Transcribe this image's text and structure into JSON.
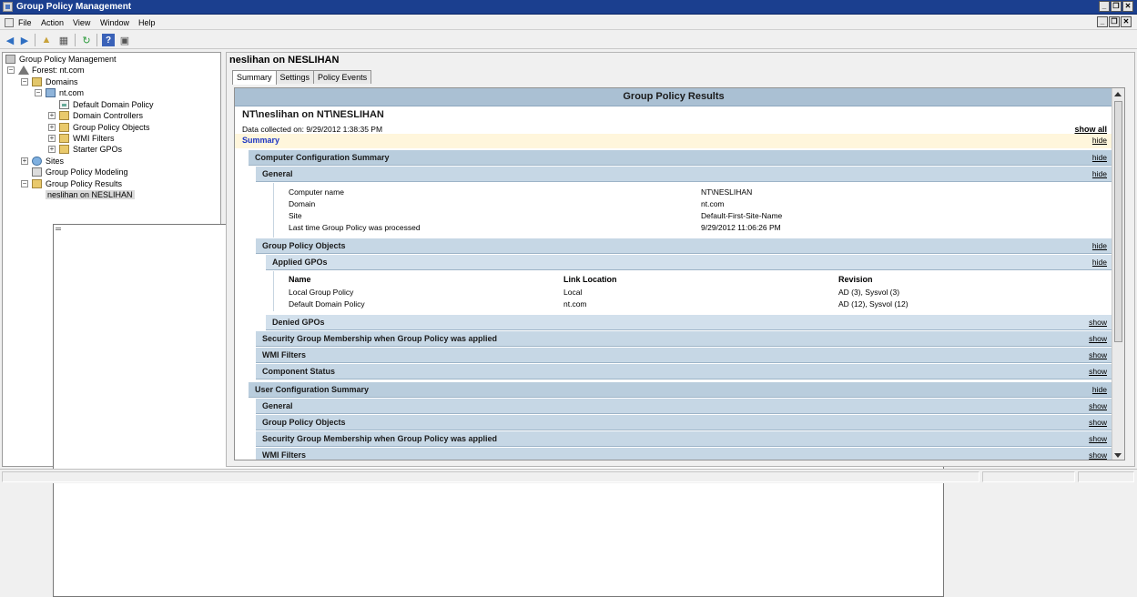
{
  "window": {
    "title": "Group Policy Management"
  },
  "menu": [
    "File",
    "Action",
    "View",
    "Window",
    "Help"
  ],
  "toolbar": [
    "back-arrow-icon",
    "forward-arrow-icon",
    "up-folder-icon",
    "show-hide-tree-icon",
    "refresh-icon",
    "help-icon",
    "properties-icon"
  ],
  "tree": {
    "root": "Group Policy Management",
    "forest": "Forest: nt.com",
    "domains": "Domains",
    "domain": "nt.com",
    "default_domain_policy": "Default Domain Policy",
    "domain_controllers": "Domain Controllers",
    "gpo": "Group Policy Objects",
    "wmi": "WMI Filters",
    "starter": "Starter GPOs",
    "sites": "Sites",
    "modeling": "Group Policy Modeling",
    "results": "Group Policy Results",
    "result_item": "neslihan on NESLIHAN"
  },
  "pane": {
    "title": "neslihan on NESLIHAN",
    "tabs": [
      "Summary",
      "Settings",
      "Policy Events"
    ]
  },
  "report": {
    "banner": "Group Policy Results",
    "heading": "NT\\neslihan on NT\\NESLIHAN",
    "collected": "Data collected on: 9/29/2012 1:38:35 PM",
    "show_all": "show all",
    "summary": "Summary",
    "hide": "hide",
    "show": "show",
    "computer_summary": "Computer Configuration Summary",
    "general": "General",
    "general_rows": [
      {
        "k": "Computer name",
        "v": "NT\\NESLIHAN"
      },
      {
        "k": "Domain",
        "v": "nt.com"
      },
      {
        "k": "Site",
        "v": "Default-First-Site-Name"
      },
      {
        "k": "Last time Group Policy was processed",
        "v": "9/29/2012 11:06:26 PM"
      }
    ],
    "gpo_section": "Group Policy Objects",
    "applied_gpos": "Applied GPOs",
    "gpo_columns": [
      "Name",
      "Link Location",
      "Revision"
    ],
    "gpo_rows": [
      {
        "name": "Local Group Policy",
        "link": "Local",
        "rev": "AD (3), Sysvol (3)"
      },
      {
        "name": "Default Domain Policy",
        "link": "nt.com",
        "rev": "AD (12), Sysvol (12)"
      }
    ],
    "denied_gpos": "Denied GPOs",
    "security_membership": "Security Group Membership when Group Policy was applied",
    "wmi_filters": "WMI Filters",
    "component_status": "Component Status",
    "user_summary": "User Configuration Summary"
  }
}
